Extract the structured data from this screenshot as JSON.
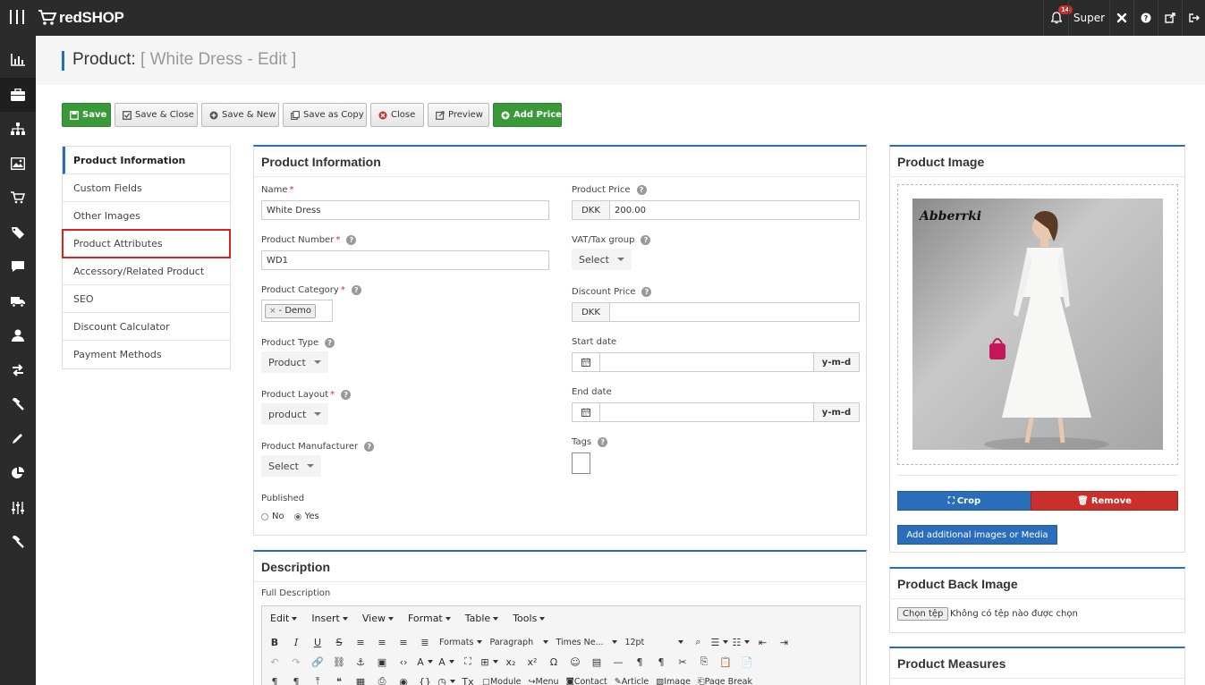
{
  "app": {
    "brand": "redSHOP"
  },
  "topnav": {
    "notif_count": "14",
    "user": "Super"
  },
  "sidebar": {
    "items": [
      "chart-icon",
      "briefcase-icon",
      "sitemap-icon",
      "image-icon",
      "cart-icon",
      "tag-icon",
      "comment-icon",
      "truck-icon",
      "user-icon",
      "exchange-icon",
      "hammer-icon",
      "pencil-icon",
      "pie-icon",
      "sliders-icon",
      "gavel-icon"
    ]
  },
  "page": {
    "title": "Product: ",
    "subtitle": "[ White Dress - Edit ]"
  },
  "toolbar": {
    "save": "Save",
    "save_close": "Save & Close",
    "save_new": "Save & New",
    "save_copy": "Save as Copy",
    "close": "Close",
    "preview": "Preview",
    "add_price": "Add Price"
  },
  "tabs": [
    "Product Information",
    "Custom Fields",
    "Other Images",
    "Product Attributes",
    "Accessory/Related Product",
    "SEO",
    "Discount Calculator",
    "Payment Methods"
  ],
  "info": {
    "heading": "Product Information",
    "name_label": "Name",
    "name_value": "White Dress",
    "number_label": "Product Number",
    "number_value": "WD1",
    "category_label": "Product Category",
    "category_chip": "- Demo",
    "type_label": "Product Type",
    "type_value": "Product",
    "layout_label": "Product Layout",
    "layout_value": "product",
    "manufacturer_label": "Product Manufacturer",
    "manufacturer_value": "Select",
    "published_label": "Published",
    "published_no": "No",
    "published_yes": "Yes",
    "price_label": "Product Price",
    "currency": "DKK",
    "price_value": "200.00",
    "vat_label": "VAT/Tax group",
    "vat_value": "Select",
    "discount_label": "Discount Price",
    "start_label": "Start date",
    "end_label": "End date",
    "date_format": "y-m-d",
    "tags_label": "Tags"
  },
  "description": {
    "heading": "Description",
    "full_label": "Full Description",
    "menus": [
      "Edit",
      "Insert",
      "View",
      "Format",
      "Table",
      "Tools"
    ],
    "formats": "Formats",
    "paragraph": "Paragraph",
    "font": "Times Ne...",
    "size": "12pt",
    "buttons": {
      "module": "Module",
      "menu": "Menu",
      "contact": "Contact",
      "article": "Article",
      "image": "Image",
      "pagebreak": "Page Break"
    }
  },
  "image_panel": {
    "heading": "Product Image",
    "logo_text": "Abberrki",
    "crop": "Crop",
    "remove": "Remove",
    "add_more": "Add additional images or Media"
  },
  "back_image": {
    "heading": "Product Back Image",
    "choose": "Chọn tệp",
    "no_file": "Không có tệp nào được chọn"
  },
  "measures": {
    "heading": "Product Measures"
  },
  "colors": {
    "accent": "#2a6ebb",
    "green": "#3a9a3a",
    "red": "#c9302c",
    "dark": "#2b2b2b"
  }
}
